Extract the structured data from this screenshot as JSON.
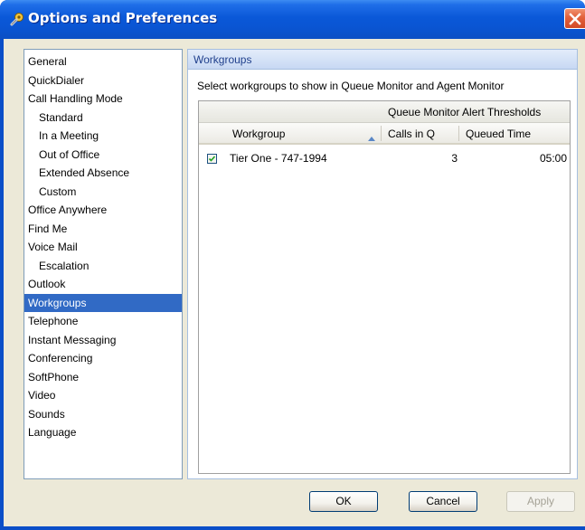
{
  "window": {
    "title": "Options and Preferences",
    "app_icon": "wrench-gear-icon",
    "close_icon": "close-icon"
  },
  "categories": [
    {
      "label": "General",
      "level": 0,
      "selected": false
    },
    {
      "label": "QuickDialer",
      "level": 0,
      "selected": false
    },
    {
      "label": "Call Handling Mode",
      "level": 0,
      "selected": false
    },
    {
      "label": "Standard",
      "level": 1,
      "selected": false
    },
    {
      "label": "In a Meeting",
      "level": 1,
      "selected": false
    },
    {
      "label": "Out of Office",
      "level": 1,
      "selected": false
    },
    {
      "label": "Extended Absence",
      "level": 1,
      "selected": false
    },
    {
      "label": "Custom",
      "level": 1,
      "selected": false
    },
    {
      "label": "Office Anywhere",
      "level": 0,
      "selected": false
    },
    {
      "label": "Find Me",
      "level": 0,
      "selected": false
    },
    {
      "label": "Voice Mail",
      "level": 0,
      "selected": false
    },
    {
      "label": "Escalation",
      "level": 1,
      "selected": false
    },
    {
      "label": "Outlook",
      "level": 0,
      "selected": false
    },
    {
      "label": "Workgroups",
      "level": 0,
      "selected": true
    },
    {
      "label": "Telephone",
      "level": 0,
      "selected": false
    },
    {
      "label": "Instant Messaging",
      "level": 0,
      "selected": false
    },
    {
      "label": "Conferencing",
      "level": 0,
      "selected": false
    },
    {
      "label": "SoftPhone",
      "level": 0,
      "selected": false
    },
    {
      "label": "Video",
      "level": 0,
      "selected": false
    },
    {
      "label": "Sounds",
      "level": 0,
      "selected": false
    },
    {
      "label": "Language",
      "level": 0,
      "selected": false
    }
  ],
  "panel": {
    "title": "Workgroups",
    "description": "Select workgroups to show in Queue Monitor and Agent Monitor"
  },
  "grid": {
    "group_header": "Queue Monitor Alert Thresholds",
    "columns": {
      "workgroup": "Workgroup",
      "calls_in_q": "Calls in Q",
      "queued_time": "Queued Time"
    },
    "sort_icon": "sort-ascending-icon",
    "rows": [
      {
        "checked": true,
        "workgroup": "Tier One - 747-1994",
        "calls_in_q": "3",
        "queued_time": "05:00"
      }
    ]
  },
  "buttons": {
    "ok": "OK",
    "cancel": "Cancel",
    "apply": "Apply",
    "apply_enabled": false
  },
  "colors": {
    "title_bar": "#0a55d6",
    "selection": "#316ac5",
    "dialog_face": "#ece9d8",
    "close_button": "#e2603a"
  }
}
